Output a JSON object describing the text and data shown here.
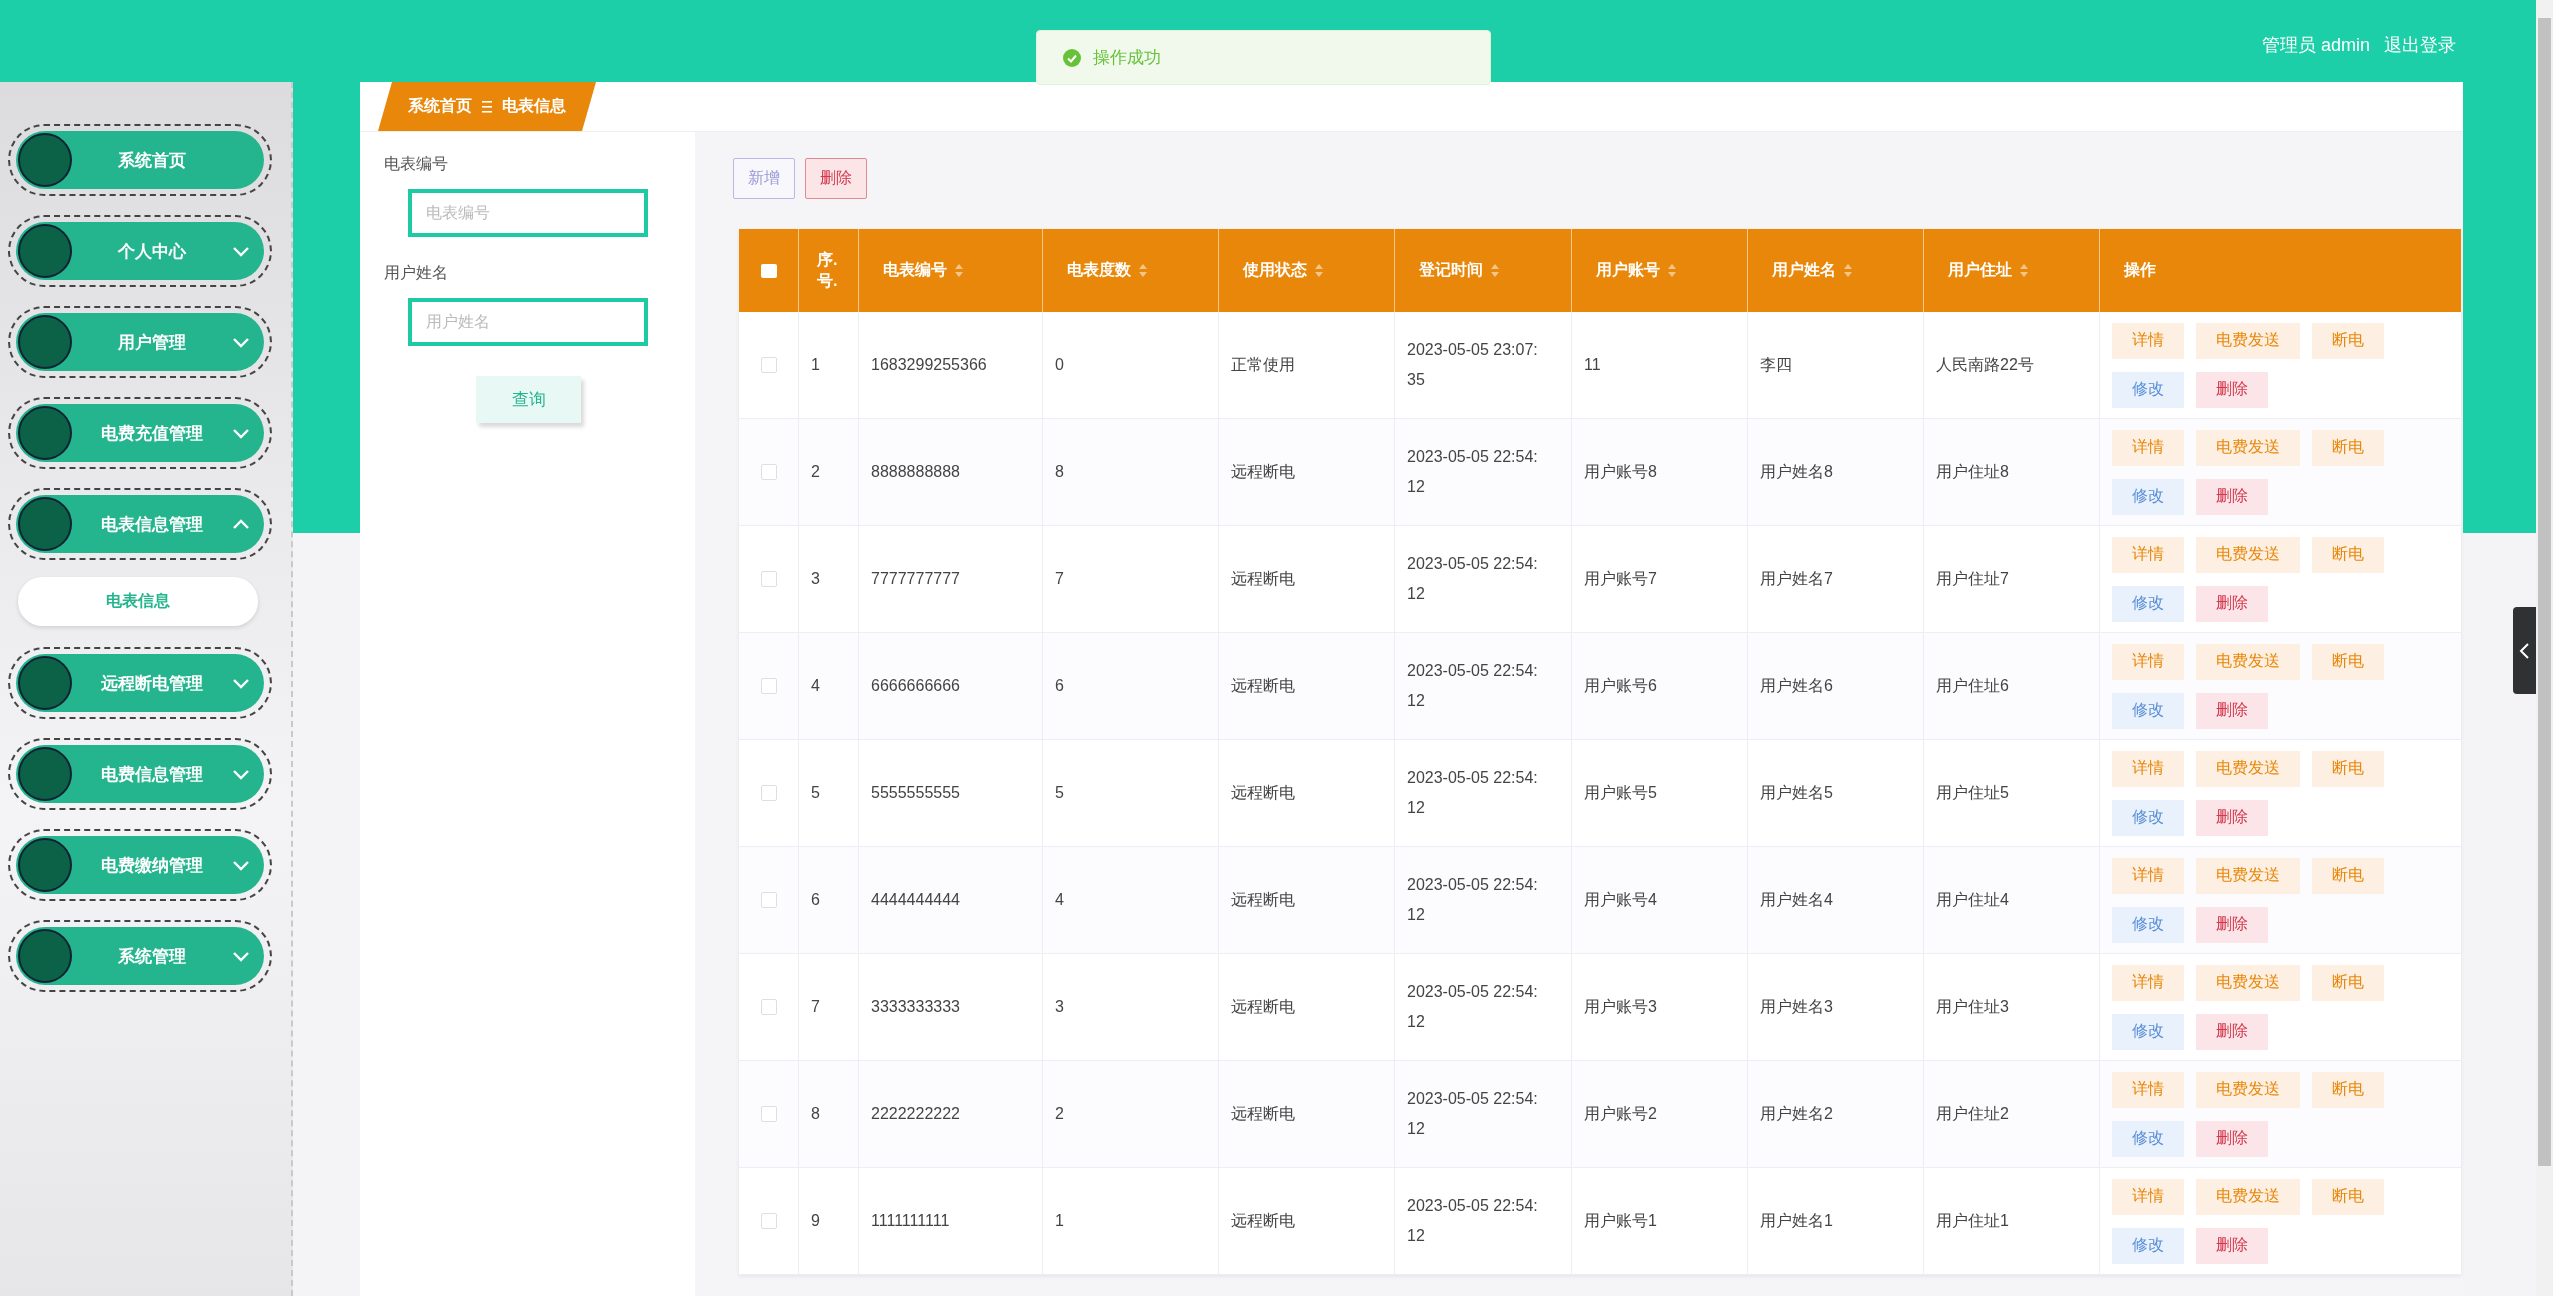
{
  "header": {
    "user_label": "管理员 admin",
    "logout": "退出登录"
  },
  "toast": {
    "message": "操作成功"
  },
  "sidebar": {
    "items": [
      {
        "label": "系统首页",
        "kind": "link"
      },
      {
        "label": "个人中心",
        "kind": "menu",
        "expanded": false
      },
      {
        "label": "用户管理",
        "kind": "menu",
        "expanded": false
      },
      {
        "label": "电费充值管理",
        "kind": "menu",
        "expanded": false
      },
      {
        "label": "电表信息管理",
        "kind": "menu",
        "expanded": true,
        "children": [
          {
            "label": "电表信息",
            "selected": true
          }
        ]
      },
      {
        "label": "远程断电管理",
        "kind": "menu",
        "expanded": false
      },
      {
        "label": "电费信息管理",
        "kind": "menu",
        "expanded": false
      },
      {
        "label": "电费缴纳管理",
        "kind": "menu",
        "expanded": false
      },
      {
        "label": "系统管理",
        "kind": "menu",
        "expanded": false
      }
    ]
  },
  "breadcrumb": [
    "系统首页",
    "电表信息"
  ],
  "search": {
    "fields": [
      {
        "label": "电表编号",
        "placeholder": "电表编号"
      },
      {
        "label": "用户姓名",
        "placeholder": "用户姓名"
      }
    ],
    "button": "查询"
  },
  "toolbar": [
    {
      "label": "新增",
      "kind": "add"
    },
    {
      "label": "删除",
      "kind": "delete"
    }
  ],
  "table": {
    "select_all_checked": false,
    "columns": [
      {
        "label": "序.号.",
        "sortable": false
      },
      {
        "label": "电表编号",
        "sortable": true
      },
      {
        "label": "电表度数",
        "sortable": true
      },
      {
        "label": "使用状态",
        "sortable": true
      },
      {
        "label": "登记时间",
        "sortable": true
      },
      {
        "label": "用户账号",
        "sortable": true
      },
      {
        "label": "用户姓名",
        "sortable": true
      },
      {
        "label": "用户住址",
        "sortable": true
      },
      {
        "label": "操作",
        "sortable": false
      }
    ],
    "rows": [
      {
        "checked": false,
        "cells": [
          "1",
          "1683299255366",
          "0",
          "正常使用",
          "2023-05-05 23:07:35",
          "11",
          "李四",
          "人民南路22号"
        ],
        "actions": [
          {
            "label": "详情",
            "kind": "detail"
          },
          {
            "label": "电费发送",
            "kind": "send"
          },
          {
            "label": "断电",
            "kind": "cut"
          },
          {
            "label": "修改",
            "kind": "edit"
          },
          {
            "label": "删除",
            "kind": "delete"
          }
        ]
      },
      {
        "checked": false,
        "cells": [
          "2",
          "8888888888",
          "8",
          "远程断电",
          "2023-05-05 22:54:12",
          "用户账号8",
          "用户姓名8",
          "用户住址8"
        ],
        "actions": [
          {
            "label": "详情",
            "kind": "detail"
          },
          {
            "label": "电费发送",
            "kind": "send"
          },
          {
            "label": "断电",
            "kind": "cut"
          },
          {
            "label": "修改",
            "kind": "edit"
          },
          {
            "label": "删除",
            "kind": "delete"
          }
        ]
      },
      {
        "checked": false,
        "cells": [
          "3",
          "7777777777",
          "7",
          "远程断电",
          "2023-05-05 22:54:12",
          "用户账号7",
          "用户姓名7",
          "用户住址7"
        ],
        "actions": [
          {
            "label": "详情",
            "kind": "detail"
          },
          {
            "label": "电费发送",
            "kind": "send"
          },
          {
            "label": "断电",
            "kind": "cut"
          },
          {
            "label": "修改",
            "kind": "edit"
          },
          {
            "label": "删除",
            "kind": "delete"
          }
        ]
      },
      {
        "checked": false,
        "cells": [
          "4",
          "6666666666",
          "6",
          "远程断电",
          "2023-05-05 22:54:12",
          "用户账号6",
          "用户姓名6",
          "用户住址6"
        ],
        "actions": [
          {
            "label": "详情",
            "kind": "detail"
          },
          {
            "label": "电费发送",
            "kind": "send"
          },
          {
            "label": "断电",
            "kind": "cut"
          },
          {
            "label": "修改",
            "kind": "edit"
          },
          {
            "label": "删除",
            "kind": "delete"
          }
        ]
      },
      {
        "checked": false,
        "cells": [
          "5",
          "5555555555",
          "5",
          "远程断电",
          "2023-05-05 22:54:12",
          "用户账号5",
          "用户姓名5",
          "用户住址5"
        ],
        "actions": [
          {
            "label": "详情",
            "kind": "detail"
          },
          {
            "label": "电费发送",
            "kind": "send"
          },
          {
            "label": "断电",
            "kind": "cut"
          },
          {
            "label": "修改",
            "kind": "edit"
          },
          {
            "label": "删除",
            "kind": "delete"
          }
        ]
      },
      {
        "checked": false,
        "cells": [
          "6",
          "4444444444",
          "4",
          "远程断电",
          "2023-05-05 22:54:12",
          "用户账号4",
          "用户姓名4",
          "用户住址4"
        ],
        "actions": [
          {
            "label": "详情",
            "kind": "detail"
          },
          {
            "label": "电费发送",
            "kind": "send"
          },
          {
            "label": "断电",
            "kind": "cut"
          },
          {
            "label": "修改",
            "kind": "edit"
          },
          {
            "label": "删除",
            "kind": "delete"
          }
        ]
      },
      {
        "checked": false,
        "cells": [
          "7",
          "3333333333",
          "3",
          "远程断电",
          "2023-05-05 22:54:12",
          "用户账号3",
          "用户姓名3",
          "用户住址3"
        ],
        "actions": [
          {
            "label": "详情",
            "kind": "detail"
          },
          {
            "label": "电费发送",
            "kind": "send"
          },
          {
            "label": "断电",
            "kind": "cut"
          },
          {
            "label": "修改",
            "kind": "edit"
          },
          {
            "label": "删除",
            "kind": "delete"
          }
        ]
      },
      {
        "checked": false,
        "cells": [
          "8",
          "2222222222",
          "2",
          "远程断电",
          "2023-05-05 22:54:12",
          "用户账号2",
          "用户姓名2",
          "用户住址2"
        ],
        "actions": [
          {
            "label": "详情",
            "kind": "detail"
          },
          {
            "label": "电费发送",
            "kind": "send"
          },
          {
            "label": "断电",
            "kind": "cut"
          },
          {
            "label": "修改",
            "kind": "edit"
          },
          {
            "label": "删除",
            "kind": "delete"
          }
        ]
      },
      {
        "checked": false,
        "cells": [
          "9",
          "1111111111",
          "1",
          "远程断电",
          "2023-05-05 22:54:12",
          "用户账号1",
          "用户姓名1",
          "用户住址1"
        ],
        "actions": [
          {
            "label": "详情",
            "kind": "detail"
          },
          {
            "label": "电费发送",
            "kind": "send"
          },
          {
            "label": "断电",
            "kind": "cut"
          },
          {
            "label": "修改",
            "kind": "edit"
          },
          {
            "label": "删除",
            "kind": "delete"
          }
        ]
      }
    ]
  }
}
